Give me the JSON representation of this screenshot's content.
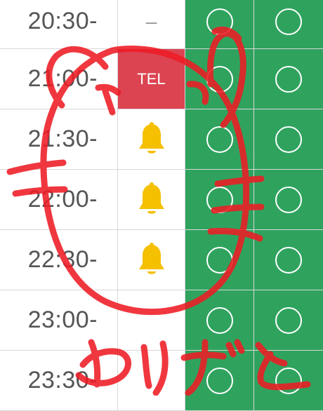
{
  "slots": [
    {
      "time": "20:30-",
      "status": "dash",
      "status_text": "–",
      "col_a": "circle",
      "col_b": "circle"
    },
    {
      "time": "21:00-",
      "status": "tel",
      "status_text": "TEL",
      "col_a": "circle",
      "col_b": "circle"
    },
    {
      "time": "21:30-",
      "status": "bell",
      "status_text": "",
      "col_a": "circle",
      "col_b": "circle"
    },
    {
      "time": "22:00-",
      "status": "bell",
      "status_text": "",
      "col_a": "circle",
      "col_b": "circle"
    },
    {
      "time": "22:30-",
      "status": "bell",
      "status_text": "",
      "col_a": "circle",
      "col_b": "circle"
    },
    {
      "time": "23:00-",
      "status": "blank",
      "status_text": "",
      "col_a": "circle",
      "col_b": "circle"
    },
    {
      "time": "23:30-",
      "status": "blank",
      "status_text": "",
      "col_a": "circle",
      "col_b": "circle"
    }
  ],
  "handwriting": {
    "text": "ありがと",
    "color": "#ee1c25"
  },
  "colors": {
    "available": "#2fa35e",
    "tel": "#dc4452",
    "bell": "#f5c000"
  },
  "icons": {
    "available": "circle-mark-icon",
    "status": "bell-icon"
  }
}
